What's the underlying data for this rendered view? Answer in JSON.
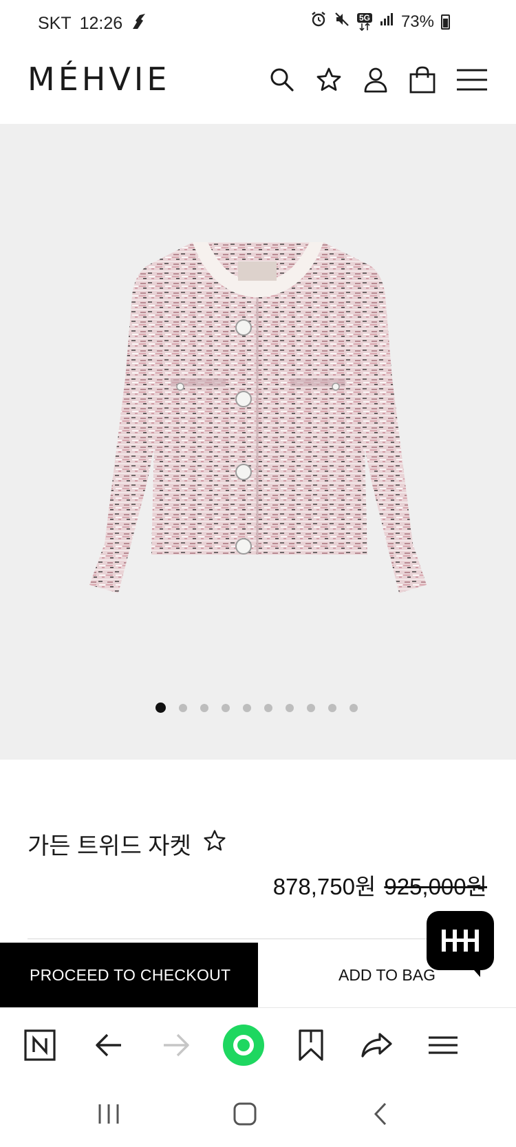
{
  "status_bar": {
    "carrier": "SKT",
    "time": "12:26",
    "network": "5G",
    "battery": "73%",
    "icons": [
      "alarm-icon",
      "mute-icon",
      "5g-icon",
      "signal-icon",
      "battery-icon"
    ]
  },
  "header": {
    "brand": "MÉHVIE",
    "icons": [
      "search-icon",
      "star-icon",
      "user-icon",
      "shopping-bag-icon",
      "menu-icon"
    ]
  },
  "gallery": {
    "image_alt": "pink tweed jacket",
    "slide_count": 10,
    "active_slide": 1
  },
  "product": {
    "title": "가든 트위드 자켓",
    "sale_price": "878,750원",
    "original_price": "925,000원"
  },
  "actions": {
    "checkout_label": "PROCEED TO CHECKOUT",
    "bag_label": "ADD TO BAG"
  },
  "chat": {
    "icon": "chat-icon",
    "label": "HH"
  },
  "browser_toolbar": {
    "items": [
      "naver-home-icon",
      "back-arrow-icon",
      "forward-arrow-icon",
      "green-dot-button",
      "bookmark-icon",
      "share-icon",
      "menu-icon"
    ]
  },
  "android_nav": {
    "items": [
      "recents-icon",
      "home-icon",
      "back-icon"
    ]
  },
  "colors": {
    "accent_green": "#1ed760",
    "black": "#000000",
    "gallery_bg": "#efefef"
  }
}
